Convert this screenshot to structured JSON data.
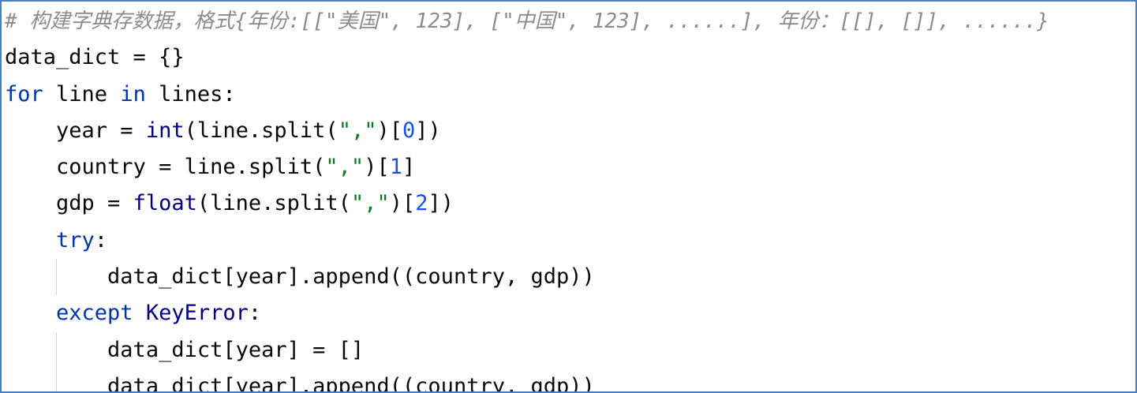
{
  "editor": {
    "lines": [
      {
        "indent": 0,
        "tokens": [
          {
            "t": "comment",
            "v": "# 构建字典存数据，格式{年份:[[\"美国\", 123], [\"中国\", 123], ......], 年份：[[], []], ......}"
          }
        ]
      },
      {
        "indent": 0,
        "tokens": [
          {
            "t": "plain",
            "v": "data_dict = {}"
          }
        ]
      },
      {
        "indent": 0,
        "tokens": [
          {
            "t": "kw",
            "v": "for"
          },
          {
            "t": "plain",
            "v": " line "
          },
          {
            "t": "kw",
            "v": "in"
          },
          {
            "t": "plain",
            "v": " lines:"
          }
        ]
      },
      {
        "indent": 1,
        "tokens": [
          {
            "t": "plain",
            "v": "year = "
          },
          {
            "t": "bi",
            "v": "int"
          },
          {
            "t": "plain",
            "v": "(line.split("
          },
          {
            "t": "str",
            "v": "\",\""
          },
          {
            "t": "plain",
            "v": ")["
          },
          {
            "t": "num",
            "v": "0"
          },
          {
            "t": "plain",
            "v": "])"
          }
        ]
      },
      {
        "indent": 1,
        "tokens": [
          {
            "t": "plain",
            "v": "country = line.split("
          },
          {
            "t": "str",
            "v": "\",\""
          },
          {
            "t": "plain",
            "v": ")["
          },
          {
            "t": "num",
            "v": "1"
          },
          {
            "t": "plain",
            "v": "]"
          }
        ]
      },
      {
        "indent": 1,
        "tokens": [
          {
            "t": "plain",
            "v": "gdp = "
          },
          {
            "t": "bi",
            "v": "float"
          },
          {
            "t": "plain",
            "v": "(line.split("
          },
          {
            "t": "str",
            "v": "\",\""
          },
          {
            "t": "plain",
            "v": ")["
          },
          {
            "t": "num",
            "v": "2"
          },
          {
            "t": "plain",
            "v": "])"
          }
        ]
      },
      {
        "indent": 1,
        "tokens": [
          {
            "t": "kw",
            "v": "try"
          },
          {
            "t": "plain",
            "v": ":"
          }
        ]
      },
      {
        "indent": 2,
        "guide": true,
        "tokens": [
          {
            "t": "plain",
            "v": "data_dict[year].append((country, gdp))"
          }
        ]
      },
      {
        "indent": 1,
        "tokens": [
          {
            "t": "kw",
            "v": "except"
          },
          {
            "t": "plain",
            "v": " "
          },
          {
            "t": "bi",
            "v": "KeyError"
          },
          {
            "t": "plain",
            "v": ":"
          }
        ]
      },
      {
        "indent": 2,
        "guide": true,
        "tokens": [
          {
            "t": "plain",
            "v": "data_dict[year] = []"
          }
        ]
      },
      {
        "indent": 2,
        "guide": true,
        "tokens": [
          {
            "t": "plain",
            "v": "data_dict[year].append((country, gdp))"
          }
        ]
      }
    ]
  },
  "colors": {
    "border": "#4a7fc0",
    "comment": "#8c8c8c",
    "keyword": "#0033b3",
    "builtin": "#000080",
    "string": "#067d17",
    "number": "#1750eb",
    "text": "#080808"
  }
}
